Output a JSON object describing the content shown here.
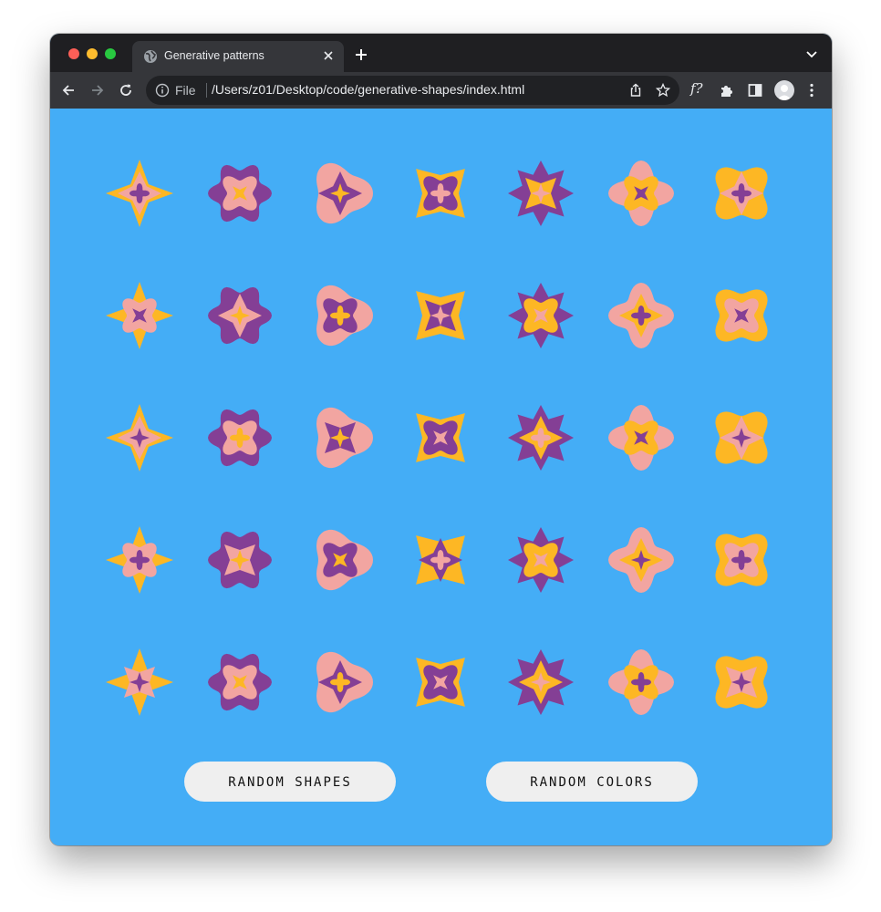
{
  "browser": {
    "tab_title": "Generative patterns",
    "address_scheme_label": "File",
    "url": "/Users/z01/Desktop/code/generative-shapes/index.html",
    "extension_label": "f?"
  },
  "page": {
    "background_color": "#44adf6",
    "palette": {
      "yellow": "#fdb724",
      "pink": "#f2a5a1",
      "purple": "#843f95",
      "blue": "#44adf6"
    },
    "buttons": {
      "random_shapes": "RANDOM SHAPES",
      "random_colors": "RANDOM COLORS"
    },
    "grid": {
      "rows": 5,
      "columns": 7
    }
  }
}
